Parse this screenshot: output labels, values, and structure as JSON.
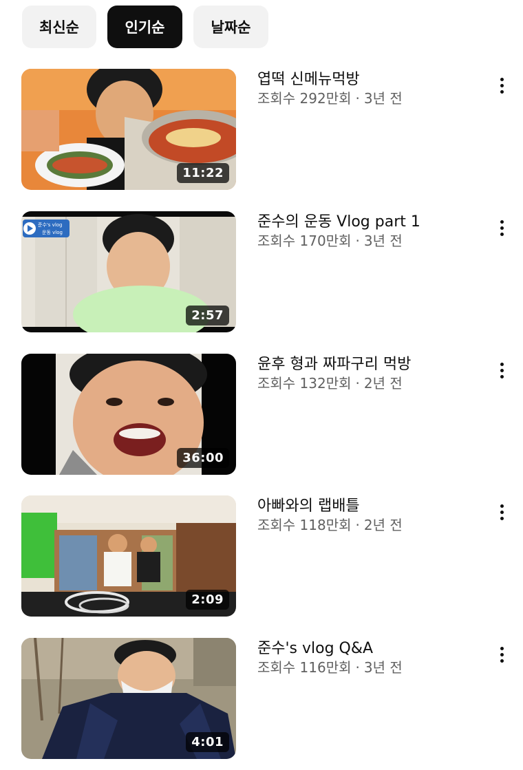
{
  "sort_chips": [
    {
      "label": "최신순",
      "selected": false
    },
    {
      "label": "인기순",
      "selected": true
    },
    {
      "label": "날짜순",
      "selected": false
    }
  ],
  "videos": [
    {
      "title": "엽떡  신메뉴먹방",
      "views": "조회수 292만회",
      "separator": "·",
      "age": "3년 전",
      "duration": "11:22"
    },
    {
      "title": "준수의 운동 Vlog part 1",
      "views": "조회수 170만회",
      "separator": "·",
      "age": "3년 전",
      "duration": "2:57",
      "thumb_badge": [
        "준수's vlog",
        "운동 vlog"
      ]
    },
    {
      "title": "윤후 형과 짜파구리 먹방",
      "views": "조회수 132만회",
      "separator": "·",
      "age": "2년 전",
      "duration": "36:00"
    },
    {
      "title": "아빠와의 랩배틀",
      "views": "조회수 118만회",
      "separator": "·",
      "age": "2년 전",
      "duration": "2:09"
    },
    {
      "title": "준수's vlog  Q&A",
      "views": "조회수 116만회",
      "separator": "·",
      "age": "3년 전",
      "duration": "4:01"
    }
  ],
  "icons": {
    "more": "more-vert-icon"
  },
  "colors": {
    "chip_selected_bg": "#0f0f0f",
    "chip_bg": "#f2f2f2",
    "secondary_text": "#606060"
  }
}
